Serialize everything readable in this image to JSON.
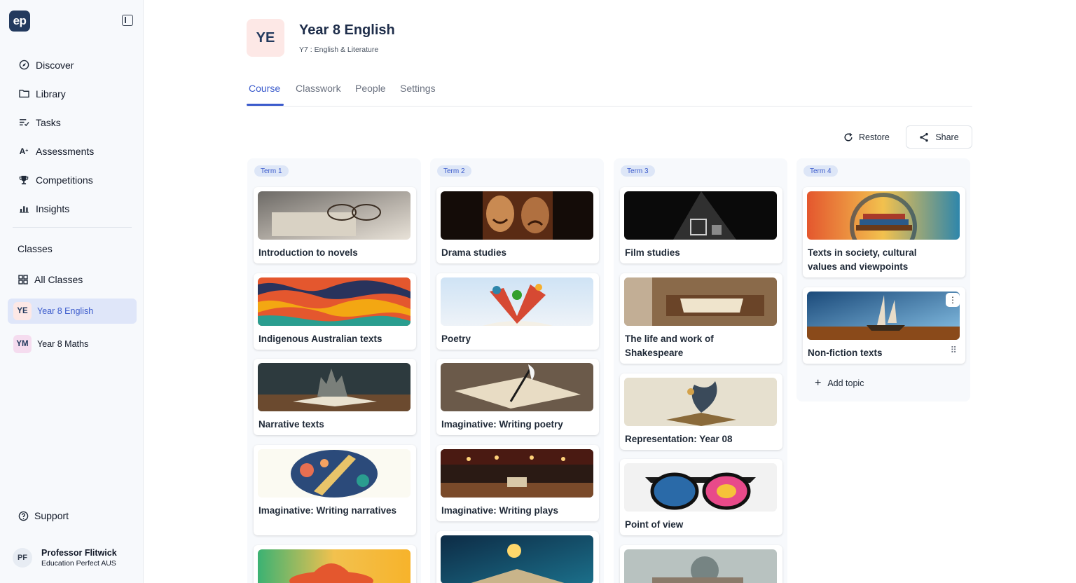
{
  "brand": {
    "logo_text": "ep"
  },
  "sidebar": {
    "nav": [
      {
        "label": "Discover",
        "icon": "compass-icon"
      },
      {
        "label": "Library",
        "icon": "folder-icon"
      },
      {
        "label": "Tasks",
        "icon": "tasks-icon"
      },
      {
        "label": "Assessments",
        "icon": "assessment-icon"
      },
      {
        "label": "Competitions",
        "icon": "trophy-icon"
      },
      {
        "label": "Insights",
        "icon": "chart-icon"
      }
    ],
    "classes_heading": "Classes",
    "all_classes": "All Classes",
    "classes": [
      {
        "badge": "YE",
        "name": "Year 8 English",
        "badge_bg": "#fde8e6",
        "badge_color": "#233a5e"
      },
      {
        "badge": "YM",
        "name": "Year 8 Maths",
        "badge_bg": "#f5dcef",
        "badge_color": "#233a5e"
      }
    ],
    "support": "Support",
    "profile": {
      "initials": "PF",
      "name": "Professor Flitwick",
      "org": "Education Perfect AUS"
    }
  },
  "course": {
    "badge": "YE",
    "title": "Year 8 English",
    "subtitle": "Y7 : English & Literature"
  },
  "tabs": [
    "Course",
    "Classwork",
    "People",
    "Settings"
  ],
  "actions": {
    "restore": "Restore",
    "share": "Share"
  },
  "terms": [
    {
      "label": "Term 1",
      "topics": [
        "Introduction to novels",
        "Indigenous Australian texts",
        "Narrative texts",
        "Imaginative: Writing narratives",
        ""
      ]
    },
    {
      "label": "Term 2",
      "topics": [
        "Drama studies",
        "Poetry",
        "Imaginative: Writing poetry",
        "Imaginative: Writing plays",
        ""
      ]
    },
    {
      "label": "Term 3",
      "topics": [
        "Film studies",
        "The life and work of Shakespeare",
        "Representation: Year 08",
        "Point of view",
        ""
      ]
    },
    {
      "label": "Term 4",
      "topics": [
        "Texts in society, cultural values and viewpoints",
        "Non-fiction texts"
      ]
    }
  ],
  "add_topic": "Add topic"
}
